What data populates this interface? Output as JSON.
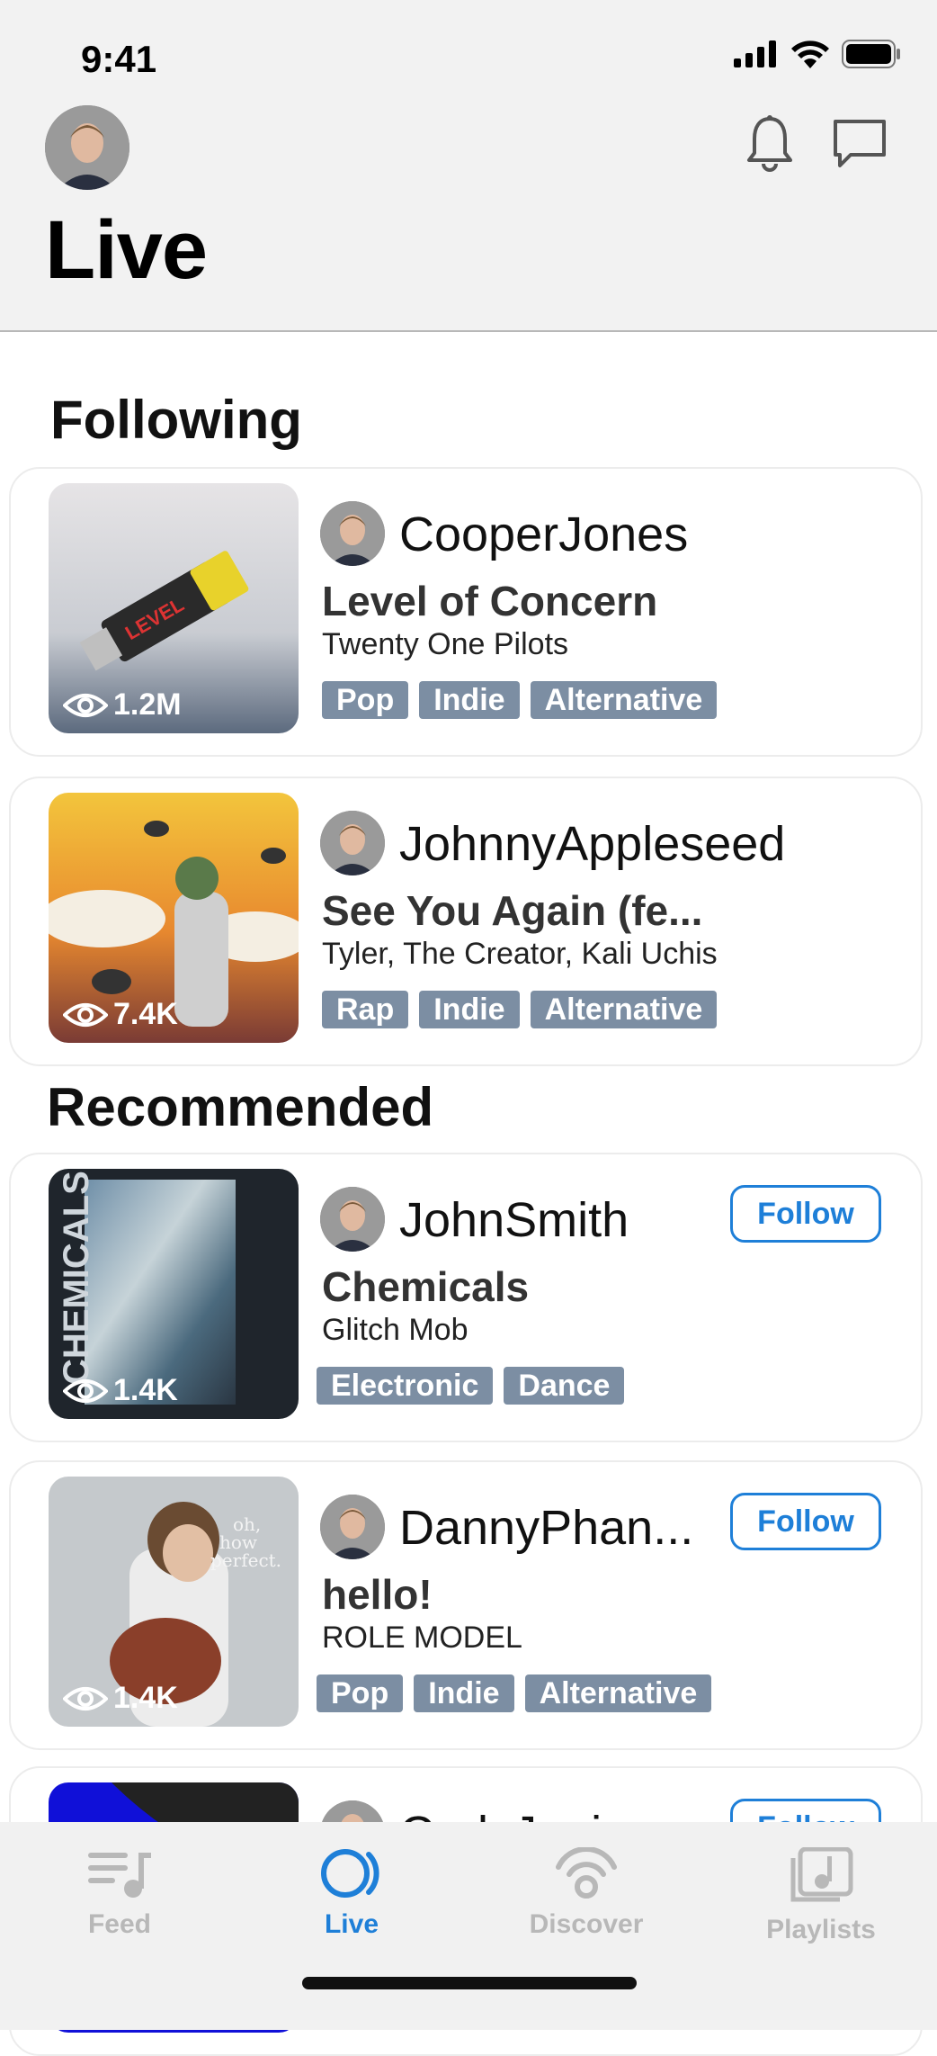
{
  "status": {
    "time": "9:41"
  },
  "header": {
    "title": "Live"
  },
  "sections": {
    "following": "Following",
    "recommended": "Recommended"
  },
  "following": [
    {
      "username": "CooperJones",
      "song": "Level of Concern",
      "artist": "Twenty One Pilots",
      "views": "1.2M",
      "tags": [
        "Pop",
        "Indie",
        "Alternative"
      ]
    },
    {
      "username": "JohnnyAppleseed",
      "song": "See You Again (fe...",
      "artist": "Tyler, The Creator, Kali Uchis",
      "views": "7.4K",
      "tags": [
        "Rap",
        "Indie",
        "Alternative"
      ]
    }
  ],
  "recommended": [
    {
      "username": "JohnSmith",
      "song": "Chemicals",
      "artist": "Glitch Mob",
      "views": "1.4K",
      "tags": [
        "Electronic",
        "Dance"
      ],
      "follow_label": "Follow"
    },
    {
      "username": "DannyPhan...",
      "song": "hello!",
      "artist": "ROLE MODEL",
      "views": "1.4K",
      "tags": [
        "Pop",
        "Indie",
        "Alternative"
      ],
      "follow_label": "Follow"
    },
    {
      "username": "CodyJanise",
      "follow_label": "Follow"
    }
  ],
  "tabbar": {
    "items": [
      {
        "label": "Feed",
        "icon": "feed-icon"
      },
      {
        "label": "Live",
        "icon": "live-icon",
        "active": true
      },
      {
        "label": "Discover",
        "icon": "discover-icon"
      },
      {
        "label": "Playlists",
        "icon": "playlists-icon"
      }
    ]
  },
  "colors": {
    "accent": "#1e7fd8",
    "tag": "#7c8ea3",
    "header_bg": "#f2f2f2"
  }
}
